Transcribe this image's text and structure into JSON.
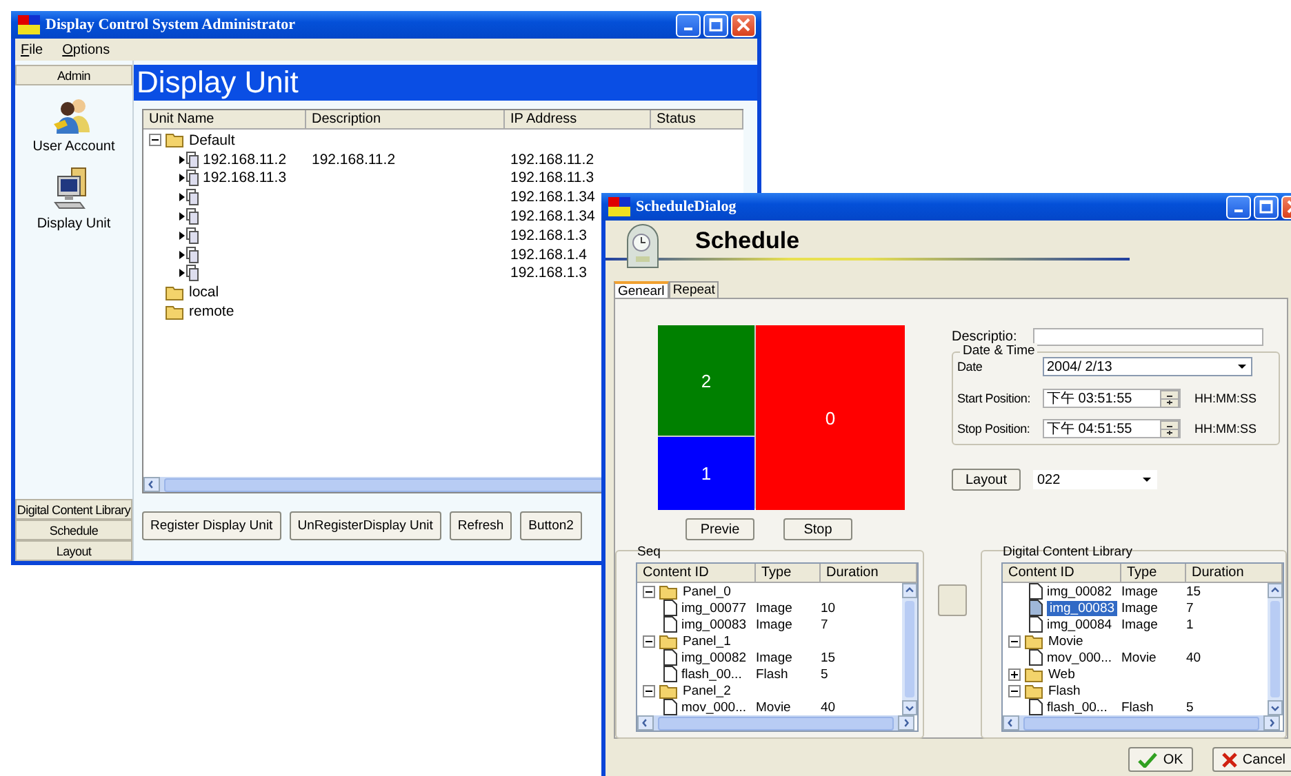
{
  "main_window": {
    "title": "Display Control System Administrator",
    "menu": [
      "File",
      "Options"
    ],
    "sidebar": {
      "header": "Admin",
      "items": [
        {
          "label": "User Account"
        },
        {
          "label": "Display Unit"
        }
      ],
      "bottom_tabs": [
        "Digital Content Library",
        "Schedule",
        "Layout"
      ]
    },
    "banner": "Display Unit",
    "unit_list": {
      "columns": [
        "Unit Name",
        "Description",
        "IP Address",
        "Status"
      ],
      "items": [
        {
          "kind": "folder",
          "name": "Default",
          "expanded": true,
          "children": [
            {
              "kind": "unit",
              "name": "192.168.11.2",
              "description": "192.168.11.2",
              "ip": "192.168.11.2"
            },
            {
              "kind": "unit",
              "name": "192.168.11.3",
              "ip": "192.168.11.3"
            },
            {
              "kind": "unit",
              "ip": "192.168.1.34"
            },
            {
              "kind": "unit",
              "ip": "192.168.1.34"
            },
            {
              "kind": "unit",
              "ip": "192.168.1.3"
            },
            {
              "kind": "unit",
              "ip": "192.168.1.4"
            },
            {
              "kind": "unit",
              "ip": "192.168.1.3"
            }
          ]
        },
        {
          "kind": "folder",
          "name": "local"
        },
        {
          "kind": "folder",
          "name": "remote"
        }
      ]
    },
    "buttons": [
      "Register Display Unit",
      "UnRegisterDisplay Unit",
      "Refresh",
      "Button2"
    ]
  },
  "schedule_dialog": {
    "title": "ScheduleDialog",
    "heading": "Schedule",
    "tabs": [
      {
        "label": "Genearl",
        "selected": true
      },
      {
        "label": "Repeat",
        "selected": false
      }
    ],
    "layout_preview": [
      {
        "label": "2",
        "color": "#008000"
      },
      {
        "label": "1",
        "color": "#0000ff"
      },
      {
        "label": "0",
        "color": "#ff0000"
      }
    ],
    "preview_buttons": [
      "Previe",
      "Stop"
    ],
    "description": {
      "label": "Descriptio:"
    },
    "date_time": {
      "legend": "Date & Time",
      "date": {
        "label": "Date",
        "value": "2004/ 2/13"
      },
      "start": {
        "label": "Start Position:",
        "value": "下午 03:51:55",
        "format": "HH:MM:SS"
      },
      "stop": {
        "label": "Stop Position:",
        "value": "下午 04:51:55",
        "format": "HH:MM:SS"
      }
    },
    "layout": {
      "button": "Layout",
      "value": "022"
    },
    "seq": {
      "label": "Seq",
      "columns": [
        "Content ID",
        "Type",
        "Duration"
      ],
      "items": [
        {
          "kind": "folder",
          "name": "Panel_0",
          "expanded": true,
          "selected": false,
          "children": [
            {
              "kind": "file",
              "name": "img_00077",
              "type": "Image",
              "duration": "10",
              "selected": false
            },
            {
              "kind": "file",
              "name": "img_00083",
              "type": "Image",
              "duration": "7",
              "selected": false
            }
          ]
        },
        {
          "kind": "folder",
          "name": "Panel_1",
          "expanded": true,
          "selected": false,
          "children": [
            {
              "kind": "file",
              "name": "img_00082",
              "type": "Image",
              "duration": "15",
              "selected": false
            },
            {
              "kind": "file",
              "name": "flash_00...",
              "type": "Flash",
              "duration": "5",
              "selected": false
            }
          ]
        },
        {
          "kind": "folder",
          "name": "Panel_2",
          "expanded": true,
          "selected": false,
          "children": [
            {
              "kind": "file",
              "name": "mov_000...",
              "type": "Movie",
              "duration": "40",
              "selected": false
            }
          ]
        }
      ]
    },
    "library": {
      "label": "Digital Content Library",
      "columns": [
        "Content ID",
        "Type",
        "Duration"
      ],
      "items": [
        {
          "kind": "folder",
          "children": [
            {
              "kind": "file",
              "name": "img_00082",
              "type": "Image",
              "duration": "15",
              "selected": false
            },
            {
              "kind": "file",
              "name": "img_00083",
              "type": "Image",
              "duration": "7",
              "selected": true
            },
            {
              "kind": "file",
              "name": "img_00084",
              "type": "Image",
              "duration": "1",
              "selected": false
            }
          ]
        },
        {
          "kind": "folder",
          "name": "Movie",
          "expanded": true,
          "selected": false,
          "children": [
            {
              "kind": "file",
              "name": "mov_000...",
              "type": "Movie",
              "duration": "40",
              "selected": false
            }
          ]
        },
        {
          "kind": "folder",
          "name": "Web",
          "expanded": false,
          "selected": false
        },
        {
          "kind": "folder",
          "name": "Flash",
          "expanded": true,
          "selected": false,
          "children": [
            {
              "kind": "file",
              "name": "flash_00...",
              "type": "Flash",
              "duration": "5",
              "selected": false
            }
          ]
        }
      ]
    },
    "ok": "OK",
    "cancel": "Cancel"
  }
}
